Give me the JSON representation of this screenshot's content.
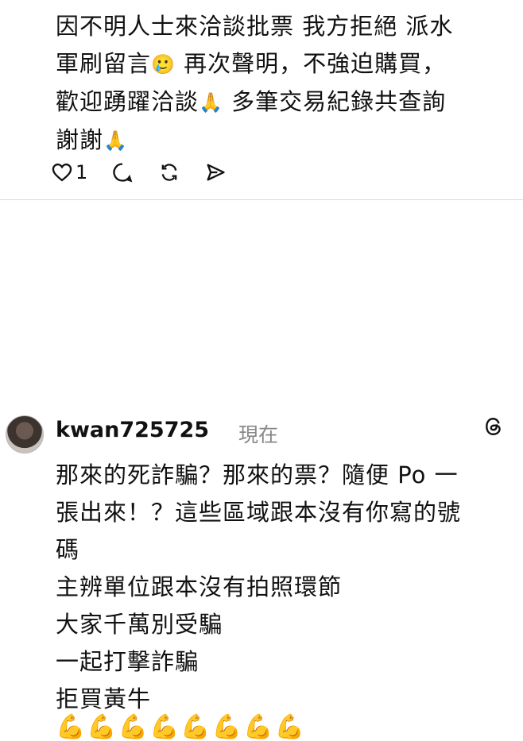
{
  "post": {
    "lines": [
      "因不明人士來洽談批票 我方拒絕 派水",
      "軍刷留言",
      "再次聲明，不強迫購買，",
      "歡迎踴躍洽談",
      "多筆交易紀錄共查詢",
      "謝謝"
    ],
    "emoji_tear": "🥲",
    "emoji_pray": "🙏",
    "like_count": "1"
  },
  "reply": {
    "username": "kwan725725",
    "timestamp": "現在",
    "lines": [
      "那來的死詐騙？那來的票？隨便 Po 一",
      "張出來！？這些區域跟本沒有你寫的號",
      "碼",
      "主辨單位跟本沒有拍照環節",
      "大家千萬別受騙",
      "一起打擊詐騙",
      "拒買黃牛"
    ],
    "muscle_emojis": "💪💪💪💪💪💪💪💪"
  },
  "icons": [
    "heart-icon",
    "comment-icon",
    "repost-icon",
    "share-icon",
    "threads-icon"
  ]
}
